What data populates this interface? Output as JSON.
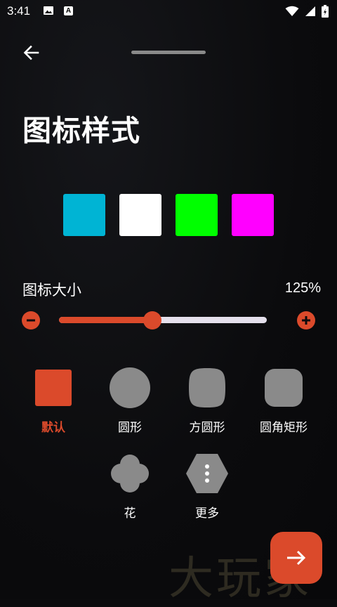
{
  "status_bar": {
    "time": "3:41",
    "icons": [
      "image-icon",
      "a-badge-icon",
      "wifi-icon",
      "signal-icon",
      "battery-icon"
    ]
  },
  "header": {
    "back_icon": "arrow-left-icon",
    "title": "图标样式"
  },
  "colors": {
    "accent": "#db4a2b",
    "shape_fill": "#8a8a8a",
    "swatches": [
      "#00b4d4",
      "#ffffff",
      "#00ff00",
      "#ff00ff"
    ]
  },
  "icon_size": {
    "label": "图标大小",
    "value_text": "125%",
    "slider_fraction": 0.45,
    "decrease_icon": "minus-icon",
    "increase_icon": "plus-icon"
  },
  "shapes": [
    {
      "label": "默认",
      "selected": true
    },
    {
      "label": "圆形",
      "selected": false
    },
    {
      "label": "方圆形",
      "selected": false
    },
    {
      "label": "圆角矩形",
      "selected": false
    },
    {
      "label": "花",
      "selected": false
    },
    {
      "label": "更多",
      "selected": false
    }
  ],
  "fab": {
    "icon": "arrow-right-icon"
  },
  "watermark": "大玩家"
}
